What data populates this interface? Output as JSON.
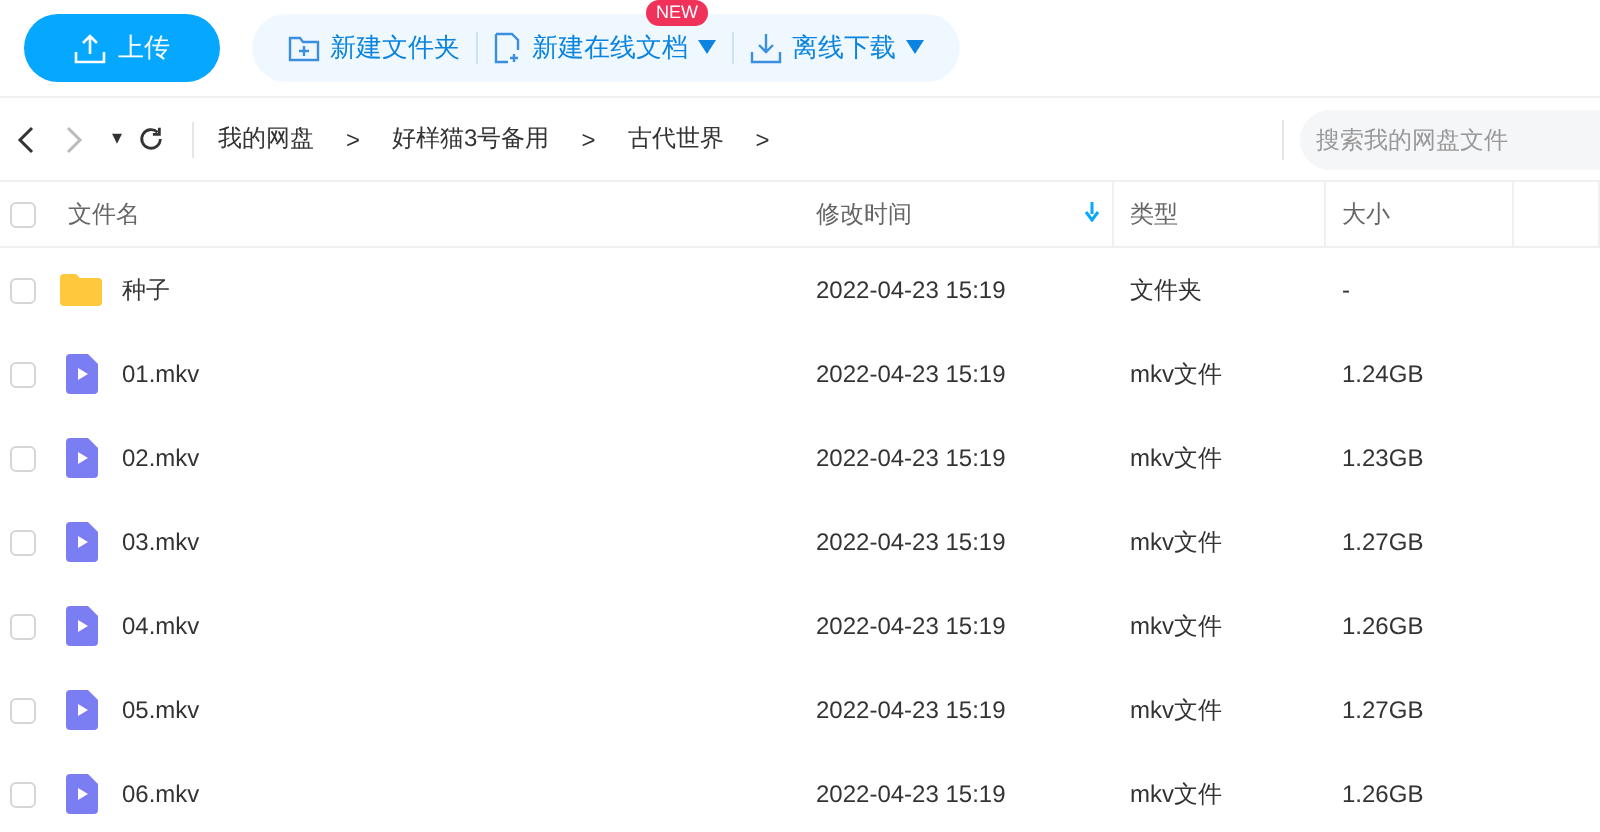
{
  "toolbar": {
    "upload": "上传",
    "actions": [
      {
        "label": "新建文件夹",
        "kind": "folder",
        "dropdown": false
      },
      {
        "label": "新建在线文档",
        "kind": "doc",
        "dropdown": true,
        "badge": "NEW"
      },
      {
        "label": "离线下载",
        "kind": "download",
        "dropdown": true
      }
    ]
  },
  "nav": {
    "dropdown": "▾",
    "breadcrumbs": [
      "我的网盘",
      "好样猫3号备用",
      "古代世界"
    ],
    "separator": ">",
    "search": {
      "placeholder": "搜索我的网盘文件"
    }
  },
  "table": {
    "select_all": {
      "checked": false
    },
    "columns": [
      {
        "label": "文件名",
        "sorted": false
      },
      {
        "label": "修改时间",
        "sorted": true
      },
      {
        "label": "类型",
        "sorted": false
      },
      {
        "label": "大小",
        "sorted": false
      }
    ],
    "rows": [
      {
        "kind": "folder",
        "name": "种子",
        "modified": "2022-04-23 15:19",
        "type": "文件夹",
        "size": "-",
        "checked": false
      },
      {
        "kind": "video",
        "name": "01.mkv",
        "modified": "2022-04-23 15:19",
        "type": "mkv文件",
        "size": "1.24GB",
        "checked": false
      },
      {
        "kind": "video",
        "name": "02.mkv",
        "modified": "2022-04-23 15:19",
        "type": "mkv文件",
        "size": "1.23GB",
        "checked": false
      },
      {
        "kind": "video",
        "name": "03.mkv",
        "modified": "2022-04-23 15:19",
        "type": "mkv文件",
        "size": "1.27GB",
        "checked": false
      },
      {
        "kind": "video",
        "name": "04.mkv",
        "modified": "2022-04-23 15:19",
        "type": "mkv文件",
        "size": "1.26GB",
        "checked": false
      },
      {
        "kind": "video",
        "name": "05.mkv",
        "modified": "2022-04-23 15:19",
        "type": "mkv文件",
        "size": "1.27GB",
        "checked": false
      },
      {
        "kind": "video",
        "name": "06.mkv",
        "modified": "2022-04-23 15:19",
        "type": "mkv文件",
        "size": "1.26GB",
        "checked": false
      }
    ]
  }
}
